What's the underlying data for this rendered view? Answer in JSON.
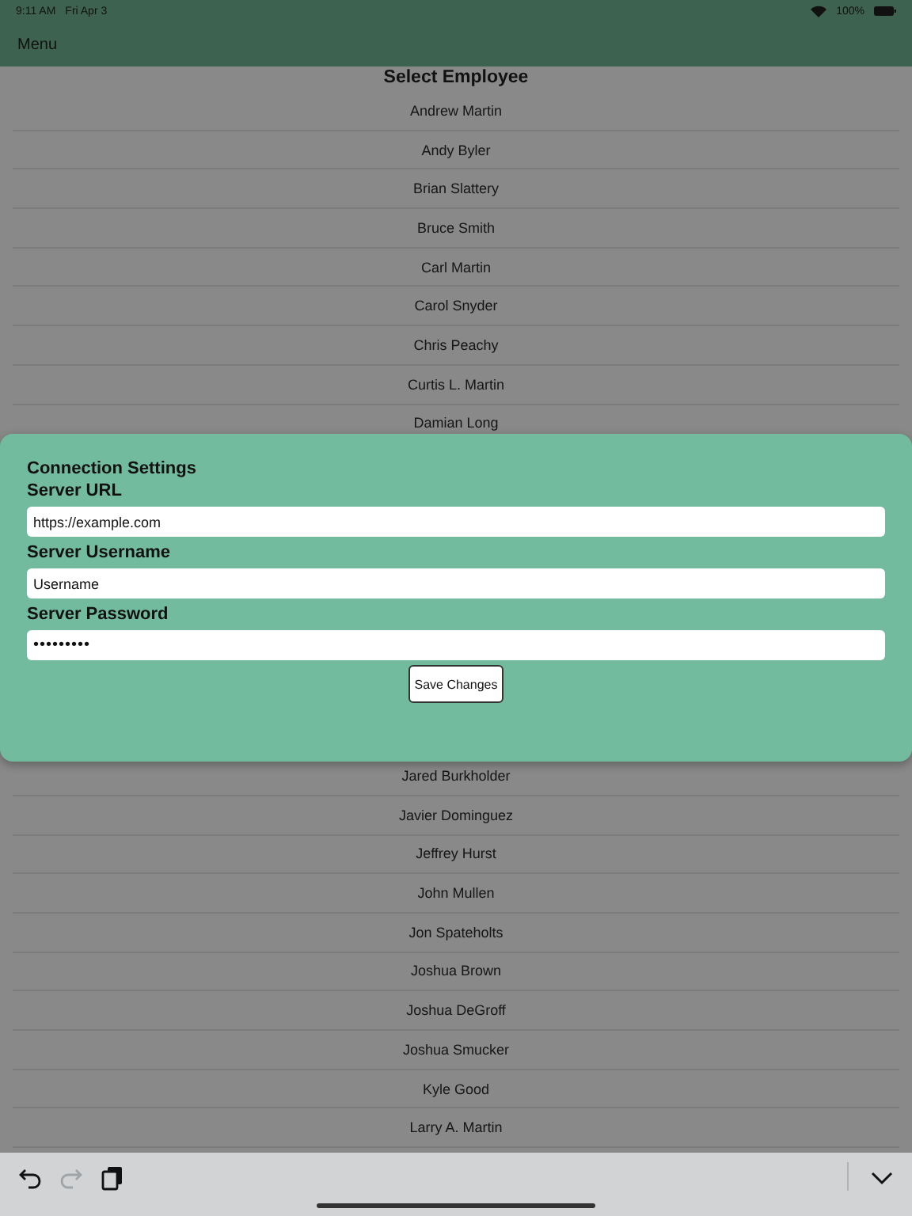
{
  "status_bar": {
    "time": "9:11 AM",
    "date": "Fri Apr 3",
    "battery": "100%"
  },
  "nav": {
    "menu": "Menu"
  },
  "list": {
    "title": "Select Employee",
    "rows_above": [
      "Andrew Martin",
      "Andy Byler",
      "Brian Slattery",
      "Bruce Smith",
      "Carl Martin",
      "Carol Snyder",
      "Chris Peachy",
      "Curtis L. Martin",
      "Damian Long"
    ],
    "rows_below": [
      "Jared Burkholder",
      "Javier Dominguez",
      "Jeffrey Hurst",
      "John Mullen",
      "Jon Spateholts",
      "Joshua Brown",
      "Joshua DeGroff",
      "Joshua Smucker",
      "Kyle Good",
      "Larry A. Martin"
    ]
  },
  "dialog": {
    "title": "Connection Settings",
    "fields": [
      {
        "label": "Server URL",
        "value": "https://example.com",
        "kind": "text"
      },
      {
        "label": "Server Username",
        "value": "Username",
        "kind": "text"
      },
      {
        "label": "Server Password",
        "value": "•••••••••",
        "kind": "password"
      }
    ],
    "button": "Save Changes"
  },
  "toolbar": {
    "tools": [
      {
        "kind": "undo",
        "disabled": false
      },
      {
        "kind": "redo",
        "disabled": true
      },
      {
        "kind": "paste",
        "disabled": false
      }
    ]
  }
}
